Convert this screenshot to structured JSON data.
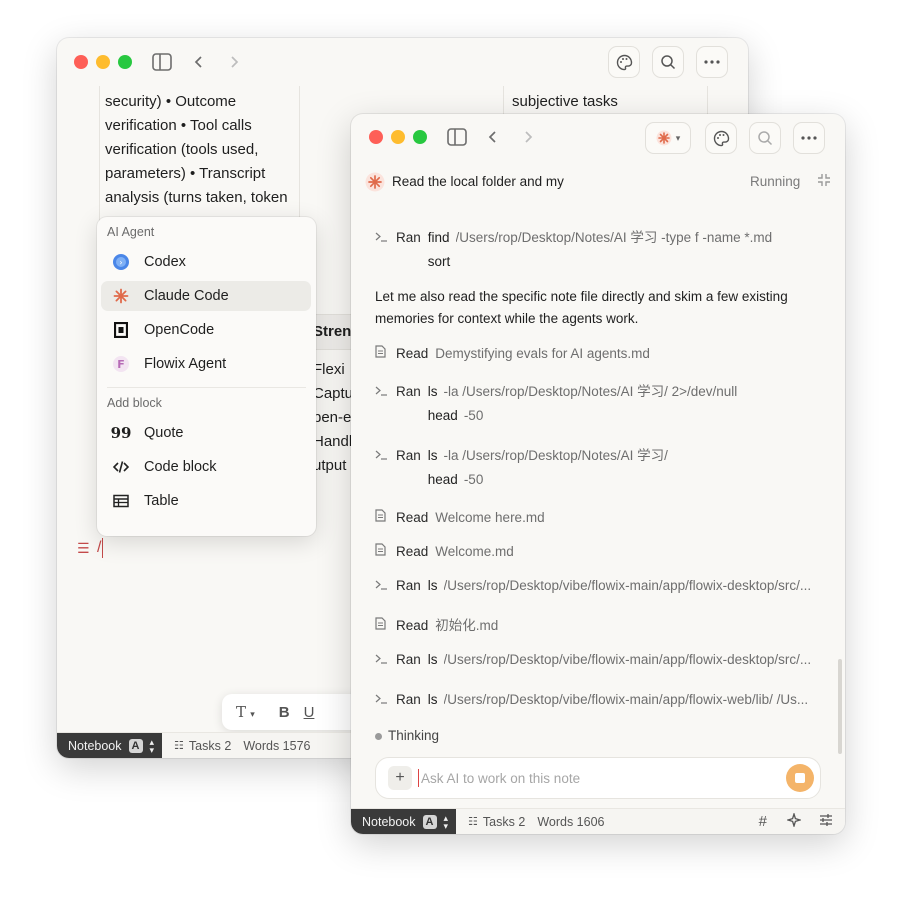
{
  "back_window": {
    "doc_lines": [
      "security) • Outcome",
      "verification • Tool calls",
      "verification (tools used,",
      "parameters) • Transcript",
      "analysis (turns taken, token"
    ],
    "right_column_text": "subjective tasks",
    "table_header_partial": "Streng",
    "table_column_partial": [
      "Flexi",
      "Captur",
      "pen-e",
      "Handle",
      "utput"
    ],
    "editor_cursor_text": "/",
    "status": {
      "notebook": "Notebook",
      "notebook_badge": "A",
      "tasks": "Tasks 2",
      "words": "Words 1576"
    },
    "format_toolbar": {
      "text_style": "T",
      "bold": "B",
      "underline": "U"
    }
  },
  "menu": {
    "section_agent": "AI Agent",
    "agents": [
      {
        "label": "Codex",
        "icon": "codex-icon"
      },
      {
        "label": "Claude Code",
        "icon": "claude-icon",
        "active": true
      },
      {
        "label": "OpenCode",
        "icon": "opencode-icon"
      },
      {
        "label": "Flowix Agent",
        "icon": "flowix-icon"
      }
    ],
    "section_block": "Add block",
    "blocks": [
      {
        "label": "Quote",
        "icon": "quote-icon"
      },
      {
        "label": "Code block",
        "icon": "code-icon"
      },
      {
        "label": "Table",
        "icon": "table-icon"
      }
    ]
  },
  "front_window": {
    "task_title": "Read the local folder and my",
    "task_status": "Running",
    "rows": [
      {
        "type": "ran",
        "kind": "Ran",
        "lines": [
          {
            "cmd": "find",
            "arg": "/Users/rop/Desktop/Notes/AI 学习 -type f -name *.md"
          },
          {
            "cmd": "sort",
            "arg": ""
          }
        ]
      },
      {
        "type": "para",
        "text": "Let me also read the specific note file directly and skim a few existing memories for context while the agents work."
      },
      {
        "type": "read",
        "kind": "Read",
        "arg": "Demystifying evals for AI agents.md"
      },
      {
        "type": "ran",
        "kind": "Ran",
        "lines": [
          {
            "cmd": "ls",
            "arg": "-la /Users/rop/Desktop/Notes/AI 学习/ 2>/dev/null"
          },
          {
            "cmd": "head",
            "arg": "-50"
          }
        ]
      },
      {
        "type": "ran",
        "kind": "Ran",
        "lines": [
          {
            "cmd": "ls",
            "arg": "-la /Users/rop/Desktop/Notes/AI 学习/"
          },
          {
            "cmd": "head",
            "arg": "-50"
          }
        ]
      },
      {
        "type": "read",
        "kind": "Read",
        "arg": "Welcome here.md"
      },
      {
        "type": "read",
        "kind": "Read",
        "arg": "Welcome.md"
      },
      {
        "type": "ran",
        "kind": "Ran",
        "lines": [
          {
            "cmd": "ls",
            "arg": "/Users/rop/Desktop/vibe/flowix-main/app/flowix-desktop/src/..."
          }
        ]
      },
      {
        "type": "read",
        "kind": "Read",
        "arg": "初始化.md"
      },
      {
        "type": "ran",
        "kind": "Ran",
        "lines": [
          {
            "cmd": "ls",
            "arg": "/Users/rop/Desktop/vibe/flowix-main/app/flowix-desktop/src/..."
          }
        ]
      },
      {
        "type": "ran",
        "kind": "Ran",
        "lines": [
          {
            "cmd": "ls",
            "arg": "/Users/rop/Desktop/vibe/flowix-main/app/flowix-web/lib/ /Us..."
          }
        ]
      }
    ],
    "thinking": "Thinking",
    "ask_placeholder": "Ask AI to work on this note",
    "status": {
      "notebook": "Notebook",
      "notebook_badge": "A",
      "tasks": "Tasks 2",
      "words": "Words 1606"
    }
  },
  "colors": {
    "accent_orange": "#f4b469",
    "claude_orange": "#e06a4a",
    "status_dark": "#3a3a3a"
  }
}
